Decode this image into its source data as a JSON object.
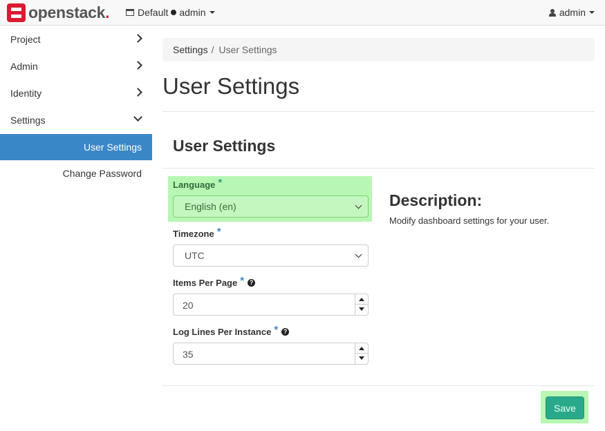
{
  "brand": {
    "name": "openstack",
    "accent": "#da1a32"
  },
  "topnav": {
    "domain": "Default",
    "project": "admin",
    "user": "admin"
  },
  "sidebar": {
    "items": [
      {
        "label": "Project",
        "expanded": false
      },
      {
        "label": "Admin",
        "expanded": false
      },
      {
        "label": "Identity",
        "expanded": false
      },
      {
        "label": "Settings",
        "expanded": true
      }
    ],
    "subitems": [
      {
        "label": "User Settings",
        "active": true
      },
      {
        "label": "Change Password",
        "active": false
      }
    ],
    "active_color": "#3a87c8"
  },
  "breadcrumb": {
    "parent": "Settings",
    "separator": "/",
    "current": "User Settings"
  },
  "page": {
    "title": "User Settings"
  },
  "form": {
    "title": "User Settings",
    "required_marker": "*",
    "help_marker": "?",
    "fields": {
      "language": {
        "label": "Language",
        "value": "English (en)"
      },
      "timezone": {
        "label": "Timezone",
        "value": "UTC"
      },
      "items_per_page": {
        "label": "Items Per Page",
        "value": "20"
      },
      "log_lines": {
        "label": "Log Lines Per Instance",
        "value": "35"
      }
    },
    "save_label": "Save",
    "save_color": "#2aa98a"
  },
  "description": {
    "title": "Description:",
    "text": "Modify dashboard settings for your user."
  }
}
